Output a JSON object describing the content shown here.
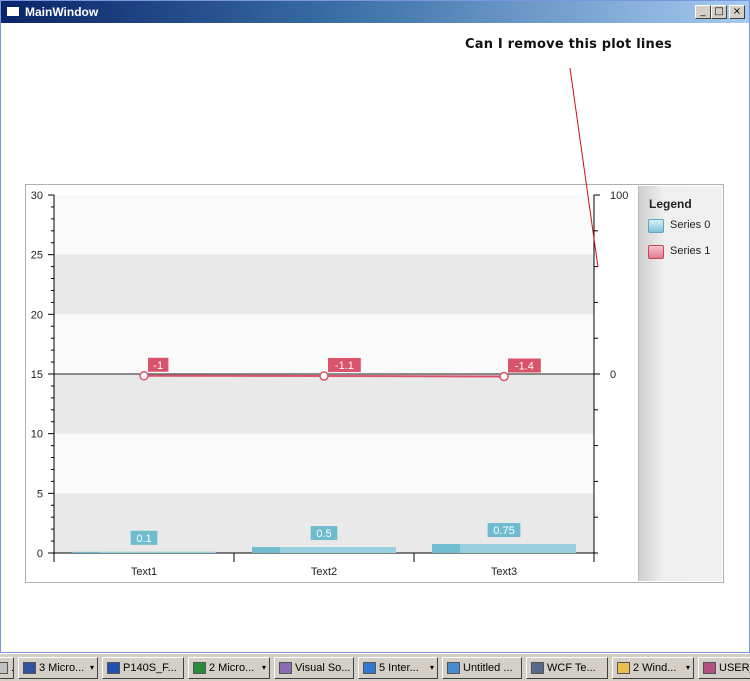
{
  "window": {
    "title": "MainWindow",
    "minimize": "_",
    "maximize": "□",
    "close": "×"
  },
  "annotation": {
    "text": "Can I remove this plot lines"
  },
  "chart_data": {
    "type": "bar",
    "categories": [
      "Text1",
      "Text2",
      "Text3"
    ],
    "series": [
      {
        "name": "Series 0",
        "type": "bar",
        "axis": "left",
        "values": [
          0.1,
          0.5,
          0.75
        ],
        "labels": [
          "0.1",
          "0.5",
          "0.75"
        ],
        "color": "#6fbccf"
      },
      {
        "name": "Series 1",
        "type": "line",
        "axis": "right",
        "values": [
          -1,
          -1.1,
          -1.4
        ],
        "labels": [
          "-1",
          "-1.1",
          "-1.4"
        ],
        "color": "#d9536b"
      }
    ],
    "y_left": {
      "min": 0,
      "max": 30,
      "ticks": [
        0,
        5,
        10,
        15,
        20,
        25,
        30
      ]
    },
    "y_right": {
      "min": -100,
      "max": 100,
      "ticks": [
        0,
        100
      ],
      "labels": [
        "0",
        "100"
      ]
    },
    "legend": {
      "title": "Legend",
      "position": "right"
    },
    "grid": "alternating bands"
  },
  "taskbar": {
    "items": [
      {
        "label": "...",
        "color": "#c0c0c0",
        "arrow": ""
      },
      {
        "label": "3 Micro...",
        "color": "#3050a0",
        "arrow": "▾"
      },
      {
        "label": "P140S_F...",
        "color": "#2050b0",
        "arrow": ""
      },
      {
        "label": "2 Micro...",
        "color": "#2a8a3a",
        "arrow": "▾"
      },
      {
        "label": "Visual So...",
        "color": "#8a6ab0",
        "arrow": ""
      },
      {
        "label": "5 Inter...",
        "color": "#2f7ad0",
        "arrow": "▾"
      },
      {
        "label": "Untitled ...",
        "color": "#4a8ad0",
        "arrow": ""
      },
      {
        "label": "WCF Te...",
        "color": "#5a6a8a",
        "arrow": ""
      },
      {
        "label": "2 Wind...",
        "color": "#e8c050",
        "arrow": "▾"
      },
      {
        "label": "USER_...",
        "color": "#b05080",
        "arrow": ""
      }
    ]
  }
}
